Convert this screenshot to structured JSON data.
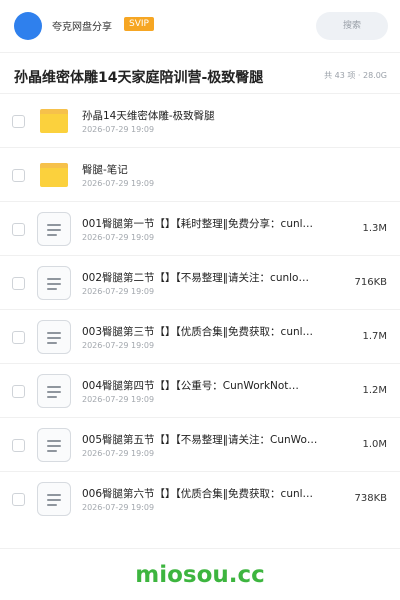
{
  "header": {
    "user_name": "夸克网盘分享",
    "badge": "SVIP",
    "search_label": "搜索",
    "accent_color": "#2f80ed",
    "badge_color": "#f6a623"
  },
  "page": {
    "title": "孙晶维密体雕14天家庭陪训营-极致臀腿",
    "summary": "共 43 项 · 28.0G"
  },
  "items": [
    {
      "type": "folder",
      "icon": "folder-icon",
      "name": "孙晶14天维密体雕-极致臀腿",
      "date": "2026-07-29 19:09",
      "size": ""
    },
    {
      "type": "folder",
      "icon": "folder-icon",
      "name": "臀腿-笔记",
      "date": "2026-07-29 19:09",
      "size": ""
    },
    {
      "type": "file",
      "icon": "document-icon",
      "name": "001臀腿第一节【】【耗时整理‖免费分享：cunl…",
      "date": "2026-07-29 19:09",
      "size": "1.3M"
    },
    {
      "type": "file",
      "icon": "document-icon",
      "name": "002臀腿第二节【】【不易整理‖请关注：cunlo…",
      "date": "2026-07-29 19:09",
      "size": "716KB"
    },
    {
      "type": "file",
      "icon": "document-icon",
      "name": "003臀腿第三节【】【优质合集‖免费获取：cunl…",
      "date": "2026-07-29 19:09",
      "size": "1.7M"
    },
    {
      "type": "file",
      "icon": "document-icon",
      "name": "004臀腿第四节【】【公重号：CunWorkNot…",
      "date": "2026-07-29 19:09",
      "size": "1.2M"
    },
    {
      "type": "file",
      "icon": "document-icon",
      "name": "005臀腿第五节【】【不易整理‖请关注：CunWo…",
      "date": "2026-07-29 19:09",
      "size": "1.0M"
    },
    {
      "type": "file",
      "icon": "document-icon",
      "name": "006臀腿第六节【】【优质合集‖免费获取：cunl…",
      "date": "2026-07-29 19:09",
      "size": "738KB"
    }
  ],
  "footer": {
    "brand": "miosou.cc",
    "brand_color": "#3db53f"
  }
}
